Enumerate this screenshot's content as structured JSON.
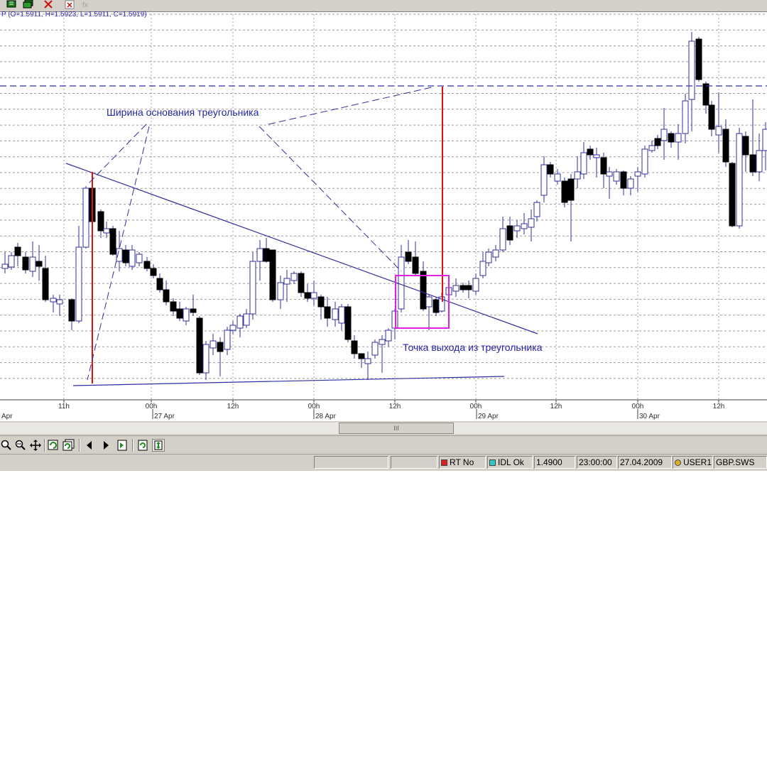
{
  "toolbar_top": {
    "icons": [
      "chart-grid-icon",
      "chart-multi-icon",
      "delete-icon",
      "close-chart-icon",
      "function-icon"
    ]
  },
  "ohlc_text": "P (O=1.5911, H=1.5923, L=1.5911, C=1.5919)",
  "chart_data": {
    "type": "candlestick",
    "symbol": "GBP.SWS",
    "ohlc_last": {
      "open": 1.5911,
      "high": 1.5923,
      "low": 1.5911,
      "close": 1.5919
    },
    "x_tick_labels": [
      "11h",
      "00h",
      "12h",
      "00h",
      "12h",
      "00h",
      "12h",
      "00h",
      "12h"
    ],
    "date_labels": [
      "Apr",
      "27 Apr",
      "28 Apr",
      "29 Apr",
      "30 Apr"
    ],
    "bullish_color": "#ffffff",
    "bearish_color": "#000000",
    "candle_outline_color": "#3030a0",
    "grid": true,
    "annotations": {
      "base_width_label": "Ширина основания треугольника",
      "exit_point_label": "Точка выхода из треугольника"
    },
    "drawing_colors": {
      "trendline": "#3030a0",
      "height_marker": "#e01010",
      "exit_box": "#e020e0",
      "target_line": "#3030a0"
    }
  },
  "scrollbar": {
    "thumb_label": "III"
  },
  "toolbar_bottom": {
    "tools": [
      "zoom-in-icon",
      "zoom-out-icon",
      "pan-icon",
      "refresh-icon",
      "refresh-all-icon",
      "scroll-left-icon",
      "scroll-right-icon",
      "go-to-end-icon",
      "autoscroll-icon",
      "autoscale-icon"
    ]
  },
  "status": {
    "rt": "RT No",
    "idl": "IDL Ok",
    "price": "1.4900",
    "time": "23:00:00",
    "date": "27.04.2009",
    "user": "USER1",
    "symbol": "GBP.SWS"
  }
}
